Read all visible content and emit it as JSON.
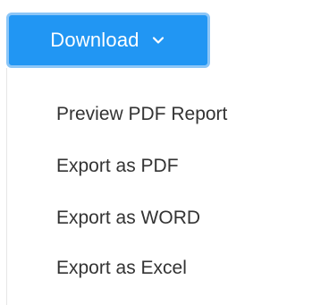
{
  "download_button": {
    "label": "Download",
    "icon": "chevron-down-icon",
    "background_color": "#2196f3",
    "border_color": "#8cc6f7"
  },
  "menu": {
    "items": [
      {
        "label": "Preview PDF Report"
      },
      {
        "label": "Export as PDF"
      },
      {
        "label": "Export as WORD"
      },
      {
        "label": "Export as Excel"
      }
    ]
  }
}
